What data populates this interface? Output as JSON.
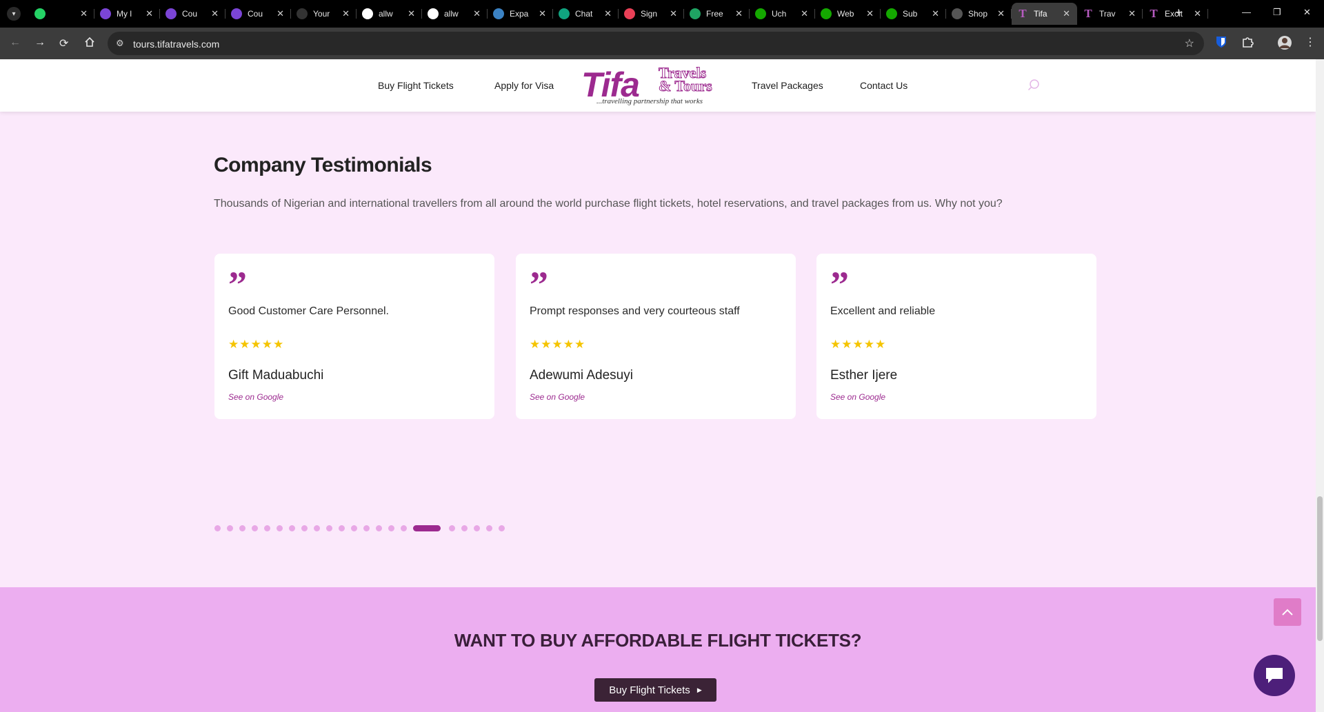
{
  "browser": {
    "tabs": [
      {
        "label": "",
        "icon": "whatsapp-icon",
        "color": "#25d366"
      },
      {
        "label": "My l",
        "icon": "app-icon",
        "color": "#7b45d6"
      },
      {
        "label": "Cou",
        "icon": "app-icon",
        "color": "#7b45d6"
      },
      {
        "label": "Cou",
        "icon": "app-icon",
        "color": "#7b45d6"
      },
      {
        "label": "Your",
        "icon": "github-icon",
        "color": "#333333"
      },
      {
        "label": "allw",
        "icon": "github-icon",
        "color": "#ffffff"
      },
      {
        "label": "allw",
        "icon": "github-icon",
        "color": "#ffffff"
      },
      {
        "label": "Expa",
        "icon": "app-icon",
        "color": "#3b82c4"
      },
      {
        "label": "Chat",
        "icon": "chatgpt-icon",
        "color": "#10a37f"
      },
      {
        "label": "Sign",
        "icon": "circle-icon",
        "color": "#e94057"
      },
      {
        "label": "Free",
        "icon": "sheets-icon",
        "color": "#1fa463"
      },
      {
        "label": "Uch",
        "icon": "upwork-icon",
        "color": "#14a800"
      },
      {
        "label": "Web",
        "icon": "upwork-icon",
        "color": "#14a800"
      },
      {
        "label": "Sub",
        "icon": "upwork-icon",
        "color": "#14a800"
      },
      {
        "label": "Shop",
        "icon": "app-icon",
        "color": "#555555"
      },
      {
        "label": "Tifa",
        "icon": "tifa-icon",
        "color": "#b65bc0",
        "active": true
      },
      {
        "label": "Trav",
        "icon": "tifa-icon",
        "color": "#b65bc0"
      },
      {
        "label": "Excit",
        "icon": "tifa-icon",
        "color": "#b65bc0"
      }
    ],
    "url": "tours.tifatravels.com"
  },
  "site": {
    "nav": {
      "buy_flight": "Buy Flight Tickets",
      "visa": "Apply for Visa",
      "packages": "Travel Packages",
      "contact": "Contact Us"
    },
    "logo": {
      "main": "Tifa",
      "sub1": "Travels",
      "sub2": "& Tours",
      "tagline": "...travelling partnership that works"
    }
  },
  "testimonials": {
    "heading": "Company Testimonials",
    "subtitle": "Thousands of Nigerian and international travellers from all around the world purchase flight tickets, hotel reservations, and travel packages from us. Why not you?",
    "quote_mark": "”",
    "cards": [
      {
        "text": "Good Customer Care Personnel.",
        "stars": "★★★★★",
        "rating": 5,
        "name": "Gift Maduabuchi",
        "link": "See on Google"
      },
      {
        "text": "Prompt responses and very courteous staff",
        "stars": "★★★★★",
        "rating": 5,
        "name": "Adewumi Adesuyi",
        "link": "See on Google"
      },
      {
        "text": "Excellent and reliable",
        "stars": "★★★★★",
        "rating": 5,
        "name": "Esther Ijere",
        "link": "See on Google"
      }
    ],
    "pagination": {
      "total": 22,
      "active_index": 16
    }
  },
  "cta": {
    "title": "WANT TO BUY AFFORDABLE FLIGHT TICKETS?",
    "button": "Buy Flight Tickets"
  },
  "colors": {
    "brand": "#9c2a8f",
    "page_bg": "#fbe9fb",
    "cta_bg": "#ecaef0",
    "star": "#f5c400"
  }
}
